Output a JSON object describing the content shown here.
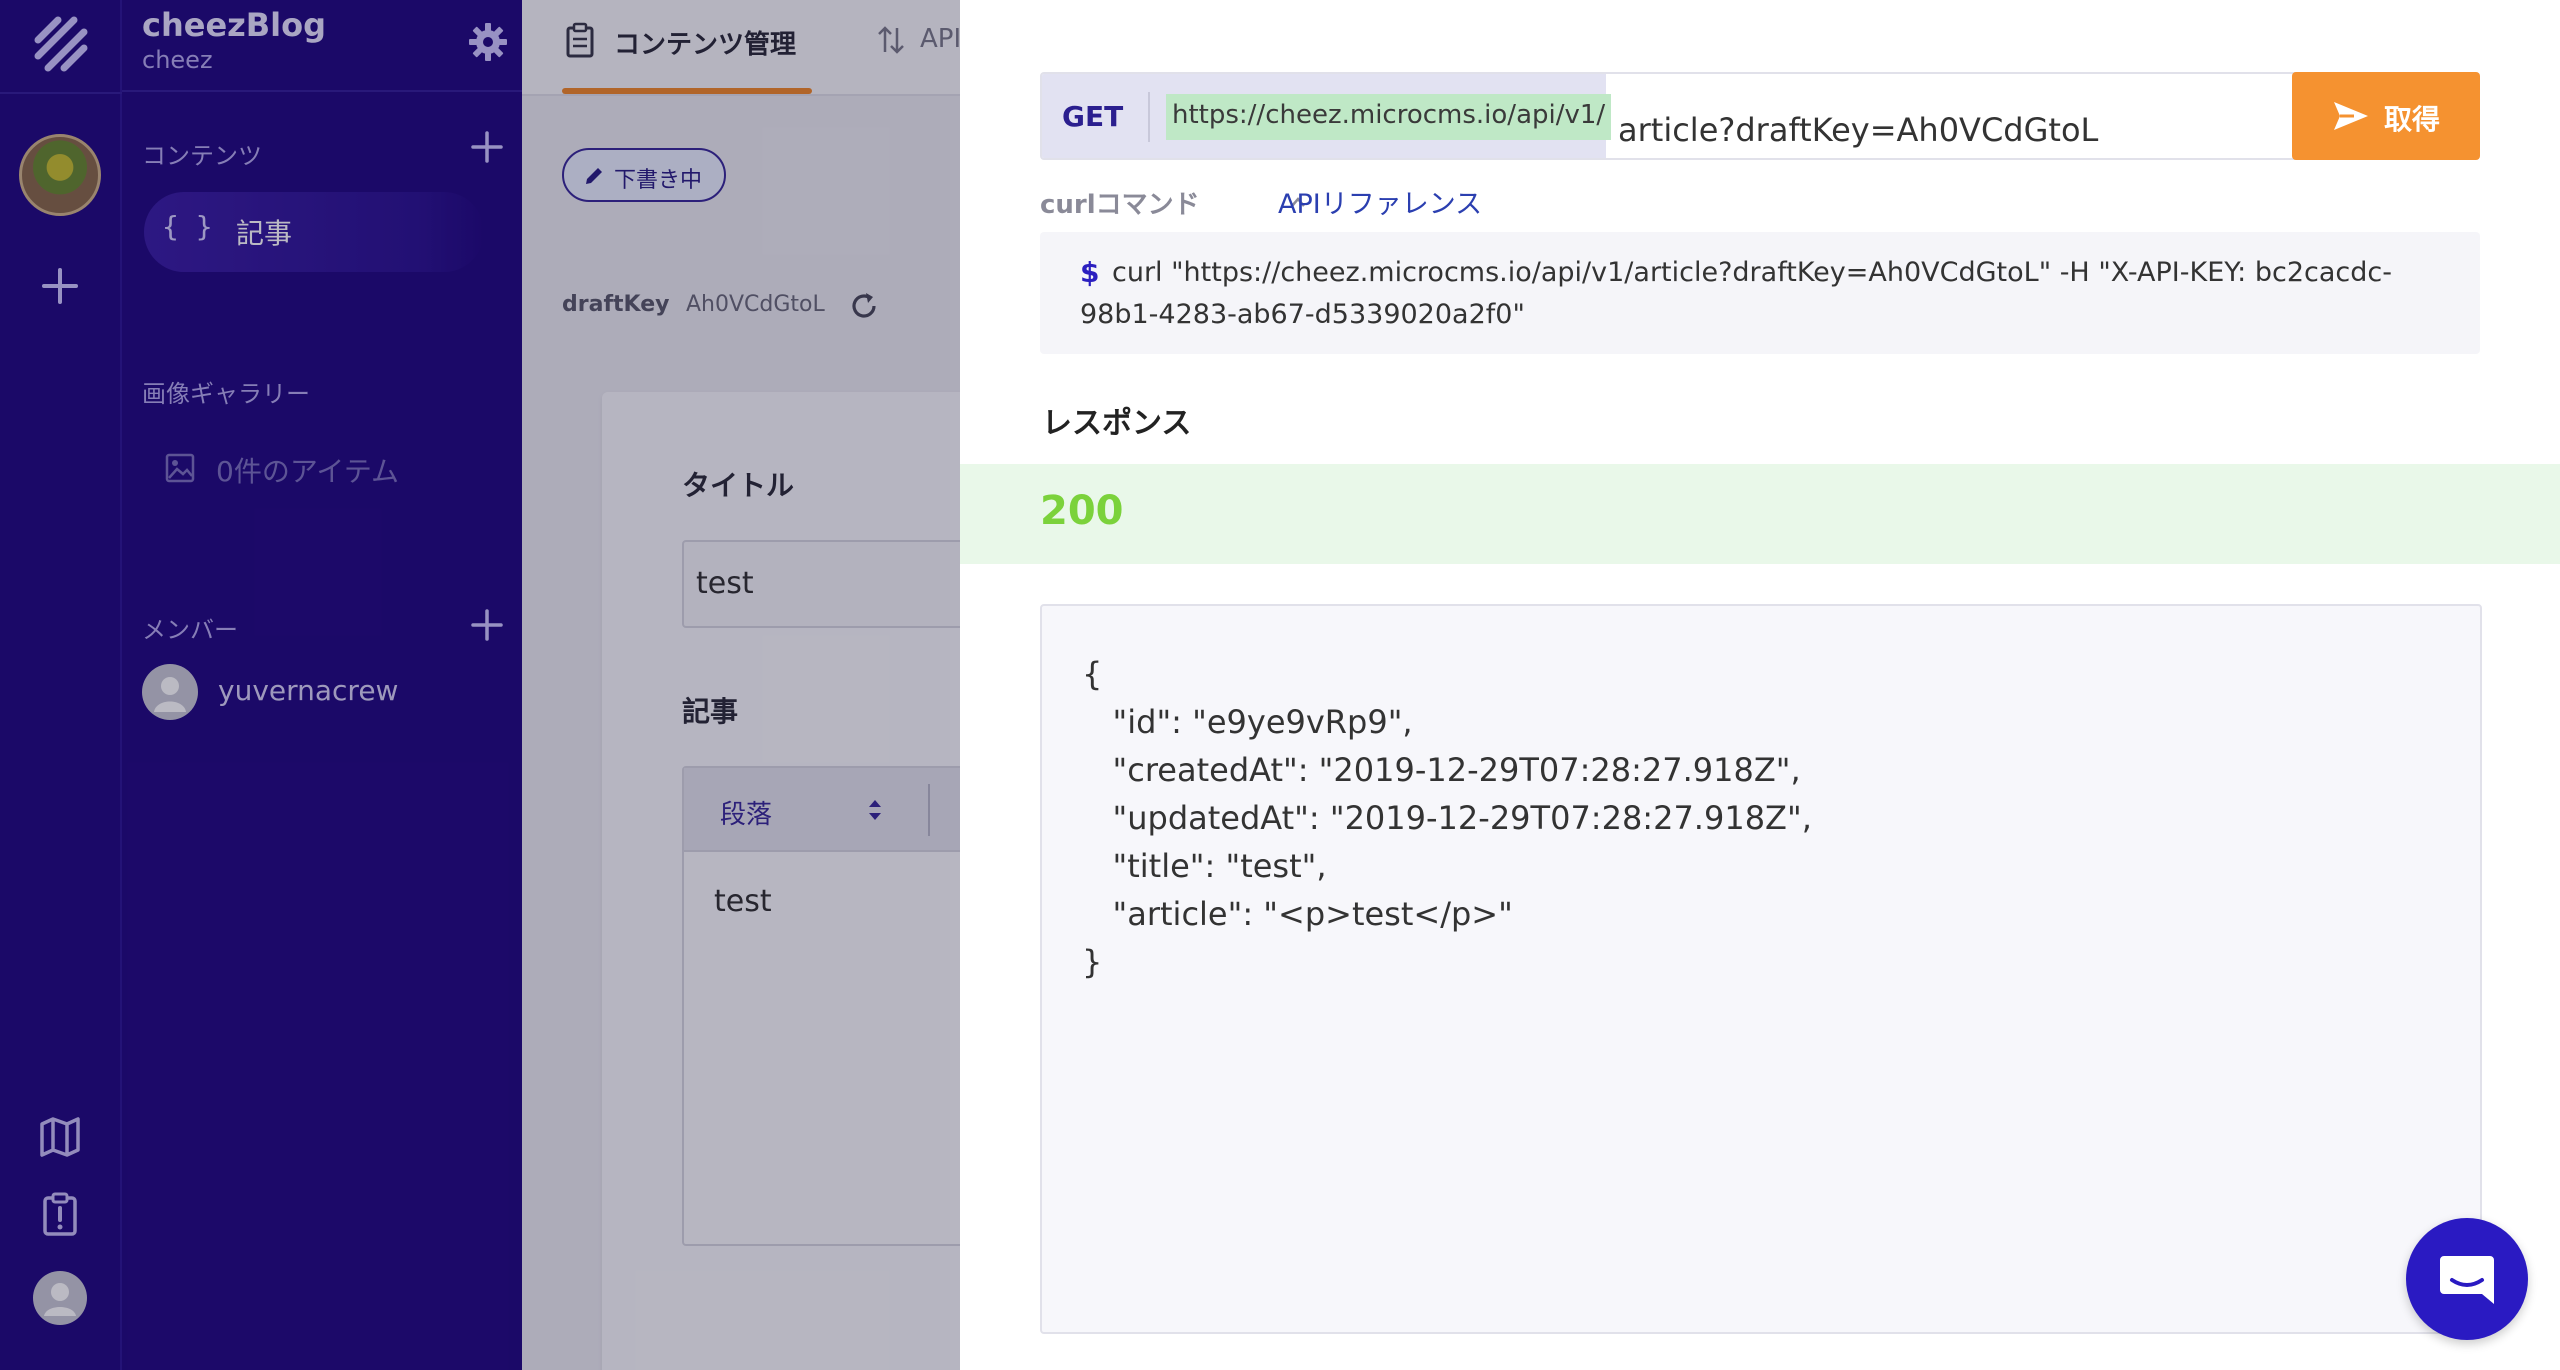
{
  "colors": {
    "rail_bg": "#220a82",
    "accent_orange": "#f59230",
    "status_green": "#7bd23b",
    "link_blue": "#2b3fb0"
  },
  "sidebar": {
    "app_name": "cheezBlog",
    "app_sub": "cheez",
    "content_section": "コンテンツ",
    "content_item": "記事",
    "gallery_section": "画像ギャラリー",
    "gallery_item": "0件のアイテム",
    "member_section": "メンバー",
    "member_name": "yuvernacrew"
  },
  "main": {
    "tab_content": "コンテンツ管理",
    "tab_api": "API",
    "draft_badge": "下書き中",
    "draft_key_label": "draftKey",
    "draft_key_value": "Ah0VCdGtoL",
    "title_label": "タイトル",
    "title_value": "test",
    "article_label": "記事",
    "paragraph_select": "段落",
    "article_body": "test"
  },
  "panel": {
    "method": "GET",
    "base_url": "https://cheez.microcms.io/api/v1/",
    "path": "article?draftKey=Ah0VCdGtoL",
    "fetch_label": "取得",
    "curl_label": "curlコマンド",
    "api_reference": "APIリファレンス",
    "curl_prompt": "$",
    "curl_command": "curl \"https://cheez.microcms.io/api/v1/article?draftKey=Ah0VCdGtoL\" -H \"X-API-KEY: bc2cacdc-98b1-4283-ab67-d5339020a2f0\"",
    "response_title": "レスポンス",
    "status_code": "200",
    "response_json": "{\n   \"id\": \"e9ye9vRp9\",\n   \"createdAt\": \"2019-12-29T07:28:27.918Z\",\n   \"updatedAt\": \"2019-12-29T07:28:27.918Z\",\n   \"title\": \"test\",\n   \"article\": \"<p>test</p>\"\n}"
  }
}
